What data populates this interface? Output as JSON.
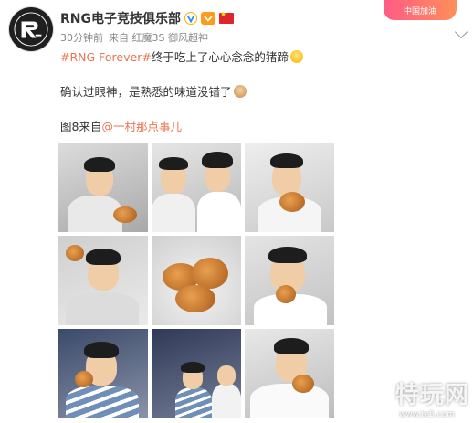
{
  "author": {
    "name": "RNG电子竞技俱乐部",
    "avatar_icon": "rng-logo-icon",
    "verified_icon": "verified-badge-icon",
    "vip_icon": "vip-badge-icon",
    "flag_icon": "china-flag-icon"
  },
  "meta": {
    "time": "30分钟前",
    "source_prefix": "来自",
    "source": "红魔3S 御风超神"
  },
  "festive_badge": "中国加油",
  "post": {
    "hashtag": "#RNG Forever#",
    "line1_text": "终于吃上了心心念念的猪蹄",
    "line2_text": "确认过眼神，是熟悉的味道没错了",
    "credit_prefix": "图8来自",
    "credit_link": "@一村那点事儿"
  },
  "photos": [
    {
      "label": "photo-1"
    },
    {
      "label": "photo-2"
    },
    {
      "label": "photo-3"
    },
    {
      "label": "photo-4"
    },
    {
      "label": "photo-5"
    },
    {
      "label": "photo-6"
    },
    {
      "label": "photo-7"
    },
    {
      "label": "photo-8"
    },
    {
      "label": "photo-9"
    }
  ],
  "watermark": {
    "text": "特玩网",
    "url": "www.te5.com"
  },
  "colors": {
    "accent": "#eb7350",
    "text": "#333333",
    "meta": "#888888"
  }
}
